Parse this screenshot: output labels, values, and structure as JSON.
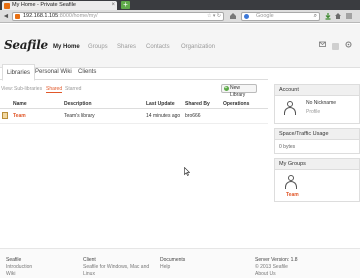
{
  "browser": {
    "tab_title": "My Home - Private Seafile",
    "tab_close": "×",
    "new_tab": "+",
    "back": "◄",
    "url_host": "192.168.1.105",
    "url_rest": ":8000/home/my/",
    "search_placeholder": "Google",
    "urlbar_icons": "☆ ▾ ↻",
    "search_icon": "⌕"
  },
  "header": {
    "logo": "Seafile",
    "nav": [
      "My Home",
      "Groups",
      "Shares",
      "Contacts",
      "Organization"
    ]
  },
  "tabs": [
    "Libraries",
    "Personal Wiki",
    "Clients"
  ],
  "view": {
    "labels": [
      "View:",
      "Sub-libraries",
      "Shared",
      "Starred"
    ],
    "new_library": "New Library",
    "new_library_icon": "+"
  },
  "table": {
    "headers": [
      "Name",
      "Description",
      "Last Update",
      "Shared By",
      "Operations"
    ],
    "rows": [
      {
        "name": "Team",
        "description": "Team's library",
        "last_update": "14 minutes ago",
        "shared_by": "bro666",
        "operations": ""
      }
    ]
  },
  "sidebar": {
    "account_title": "Account",
    "nickname": "No Nickname",
    "profile": "Profile",
    "space_title": "Space/Traffic Usage",
    "usage": "0 bytes",
    "groups_title": "My Groups",
    "group_name": "Team"
  },
  "footer": {
    "col1_title": "Seafile",
    "col1_items": [
      "Introduction",
      "Wiki"
    ],
    "col2_title": "Client",
    "col2_items": [
      "Seafile for Windows, Mac and",
      "Linux"
    ],
    "col3_title": "Documents",
    "col3_items": [
      "Help"
    ],
    "col4_title": "Server Version: 1.8",
    "col4_items": [
      "© 2013 Seafile",
      "About Us"
    ]
  },
  "colors": {
    "accent": "#e1582a",
    "header_bg": "#f5f5f5",
    "new_library_green": "#5aa845"
  }
}
